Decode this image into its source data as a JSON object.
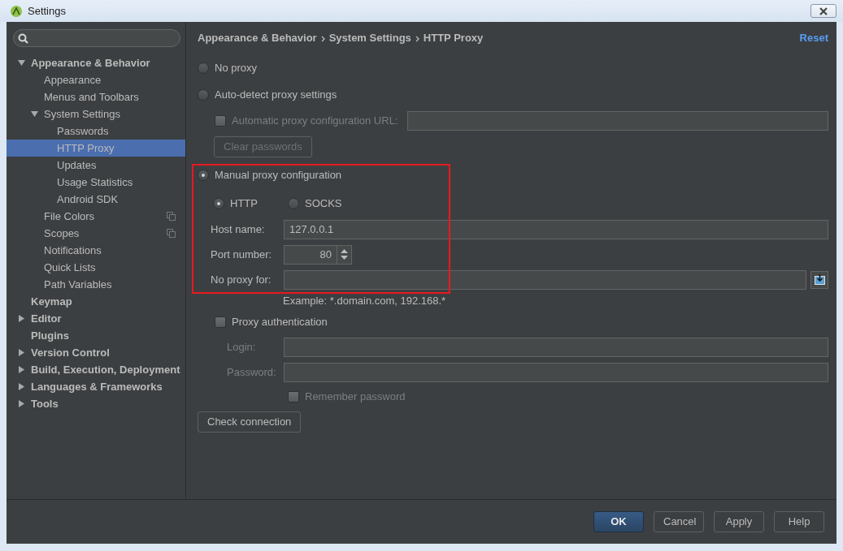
{
  "window": {
    "title": "Settings"
  },
  "sidebar": {
    "tree": [
      {
        "label": "Appearance & Behavior",
        "expanded": true,
        "selected": false,
        "children": [
          {
            "label": "Appearance",
            "selected": false
          },
          {
            "label": "Menus and Toolbars",
            "selected": false
          },
          {
            "label": "System Settings",
            "expanded": true,
            "selected": false,
            "children": [
              {
                "label": "Passwords",
                "selected": false
              },
              {
                "label": "HTTP Proxy",
                "selected": true
              },
              {
                "label": "Updates",
                "selected": false
              },
              {
                "label": "Usage Statistics",
                "selected": false
              },
              {
                "label": "Android SDK",
                "selected": false
              }
            ]
          },
          {
            "label": "File Colors",
            "selected": false,
            "has_copy_icon": true
          },
          {
            "label": "Scopes",
            "selected": false,
            "has_copy_icon": true
          },
          {
            "label": "Notifications",
            "selected": false
          },
          {
            "label": "Quick Lists",
            "selected": false
          },
          {
            "label": "Path Variables",
            "selected": false
          }
        ]
      },
      {
        "label": "Keymap",
        "selected": false
      },
      {
        "label": "Editor",
        "expanded": false,
        "selected": false
      },
      {
        "label": "Plugins",
        "selected": false
      },
      {
        "label": "Version Control",
        "expanded": false,
        "selected": false
      },
      {
        "label": "Build, Execution, Deployment",
        "expanded": false,
        "selected": false
      },
      {
        "label": "Languages & Frameworks",
        "expanded": false,
        "selected": false
      },
      {
        "label": "Tools",
        "expanded": false,
        "selected": false
      }
    ]
  },
  "breadcrumb": [
    "Appearance & Behavior",
    "System Settings",
    "HTTP Proxy"
  ],
  "reset_link": "Reset",
  "no_proxy": {
    "label": "No proxy",
    "selected": false
  },
  "auto_detect": {
    "label": "Auto-detect proxy settings",
    "selected": false
  },
  "auto_config_url": {
    "label": "Automatic proxy configuration URL:",
    "checked": false,
    "disabled": true
  },
  "clear_passwords": {
    "label": "Clear passwords",
    "disabled": true
  },
  "manual": {
    "label": "Manual proxy configuration",
    "selected": true,
    "highlighted": true,
    "protocols": [
      {
        "label": "HTTP",
        "selected": true
      },
      {
        "label": "SOCKS",
        "selected": false
      }
    ],
    "host_name": {
      "label": "Host name:",
      "value": "127.0.0.1"
    },
    "port_number": {
      "label": "Port number:",
      "value": "80"
    },
    "no_proxy_for": {
      "label": "No proxy for:"
    }
  },
  "example_hint": "Example: *.domain.com, 192.168.*",
  "proxy_authentication": {
    "label": "Proxy authentication",
    "checked": false
  },
  "login": {
    "label": "Login:",
    "disabled": true
  },
  "password": {
    "label": "Password:",
    "disabled": true
  },
  "remember_password": {
    "label": "Remember password",
    "checked": false,
    "disabled": true
  },
  "check_connection": "Check connection",
  "footer_buttons": [
    {
      "label": "OK",
      "primary": true
    },
    {
      "label": "Cancel",
      "primary": false
    },
    {
      "label": "Apply",
      "primary": false
    },
    {
      "label": "Help",
      "primary": false
    }
  ]
}
